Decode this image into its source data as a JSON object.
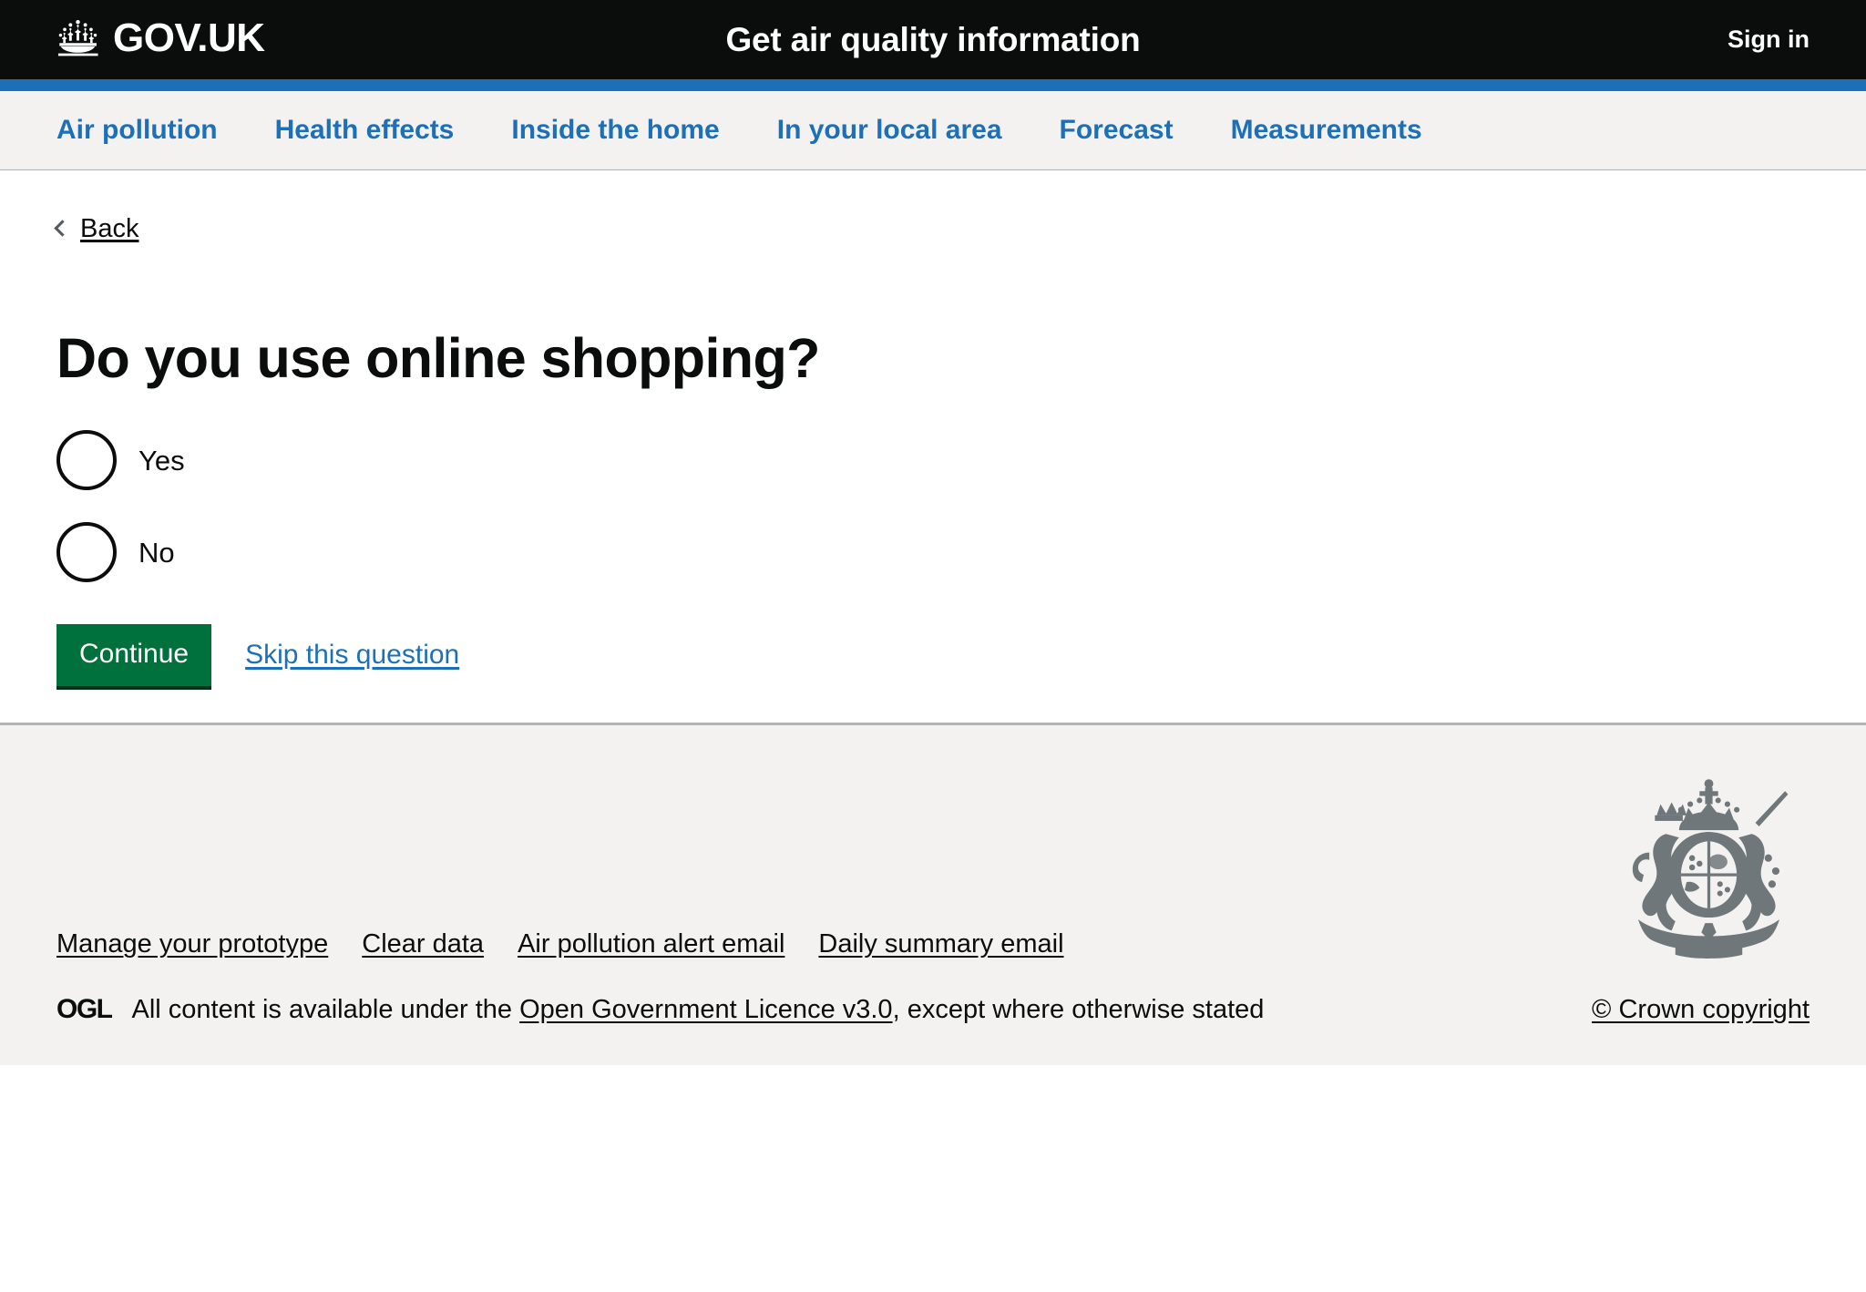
{
  "header": {
    "logo_text": "GOV.UK",
    "logo_icon": "crown-icon",
    "service_name": "Get air quality information",
    "sign_in_label": "Sign in",
    "background_color": "#0b0c0c",
    "accent_color": "#1d70b8"
  },
  "nav": {
    "items": [
      {
        "label": "Air pollution"
      },
      {
        "label": "Health effects"
      },
      {
        "label": "Inside the home"
      },
      {
        "label": "In your local area"
      },
      {
        "label": "Forecast"
      },
      {
        "label": "Measurements"
      }
    ],
    "link_color": "#1d70b8",
    "background_color": "#f3f2f1"
  },
  "main": {
    "back_label": "Back",
    "back_icon": "chevron-left-icon",
    "heading": "Do you use online shopping?",
    "radios": [
      {
        "label": "Yes",
        "value": "yes",
        "checked": false
      },
      {
        "label": "No",
        "value": "no",
        "checked": false
      }
    ],
    "continue_label": "Continue",
    "continue_color": "#00703c",
    "skip_label": "Skip this question",
    "skip_color": "#1d70b8"
  },
  "footer": {
    "links": [
      {
        "label": "Manage your prototype"
      },
      {
        "label": "Clear data"
      },
      {
        "label": "Air pollution alert email"
      },
      {
        "label": "Daily summary email"
      }
    ],
    "ogl_logo_text": "OGL",
    "licence_prefix": "All content is available under the ",
    "licence_link": "Open Government Licence v3.0",
    "licence_suffix": ", except where otherwise stated",
    "crown_copyright": "© Crown copyright",
    "royal_arms_icon": "royal-coat-of-arms-icon",
    "background_color": "#f3f2f1",
    "border_color": "#b1b4b6"
  }
}
